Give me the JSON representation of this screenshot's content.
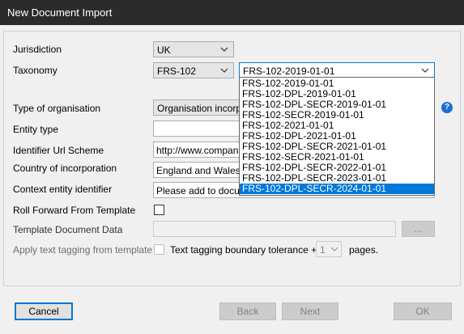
{
  "window": {
    "title": "New Document Import"
  },
  "form": {
    "jurisdiction": {
      "label": "Jurisdiction",
      "value": "UK"
    },
    "taxonomy": {
      "label": "Taxonomy",
      "value": "FRS-102",
      "version_value": "FRS-102-2019-01-01"
    },
    "taxonomy_options": [
      "FRS-102-2019-01-01",
      "FRS-102-DPL-2019-01-01",
      "FRS-102-DPL-SECR-2019-01-01",
      "FRS-102-SECR-2019-01-01",
      "FRS-102-2021-01-01",
      "FRS-102-DPL-2021-01-01",
      "FRS-102-DPL-SECR-2021-01-01",
      "FRS-102-SECR-2021-01-01",
      "FRS-102-DPL-SECR-2022-01-01",
      "FRS-102-DPL-SECR-2023-01-01",
      "FRS-102-DPL-SECR-2024-01-01"
    ],
    "taxonomy_selected_index": 10,
    "type_of_organisation": {
      "label": "Type of organisation",
      "value": "Organisation incorporat"
    },
    "entity_type": {
      "label": "Entity type",
      "value": ""
    },
    "identifier_url_scheme": {
      "label": "Identifier Url Scheme",
      "value": "http://www.companies"
    },
    "country_of_incorporation": {
      "label": "Country of incorporation",
      "value": "England and Wales (E"
    },
    "context_entity_identifier": {
      "label": "Context entity identifier",
      "value": "Please add to docume"
    },
    "roll_forward": {
      "label": "Roll Forward From Template",
      "checked": false
    },
    "template_document_data": {
      "label": "Template Document Data",
      "value": "",
      "browse_label": "..."
    },
    "apply_text_tagging": {
      "label": "Apply text tagging from template",
      "checkbox_label": "Text tagging boundary tolerance +/-",
      "tolerance_value": "1",
      "unit_label": "pages."
    }
  },
  "help_icon_glyph": "?",
  "buttons": {
    "cancel": "Cancel",
    "back": "Back",
    "next": "Next",
    "ok": "OK"
  },
  "colors": {
    "titlebar": "#2b2b2b",
    "selection": "#0078d7",
    "help": "#1a6fd0"
  }
}
